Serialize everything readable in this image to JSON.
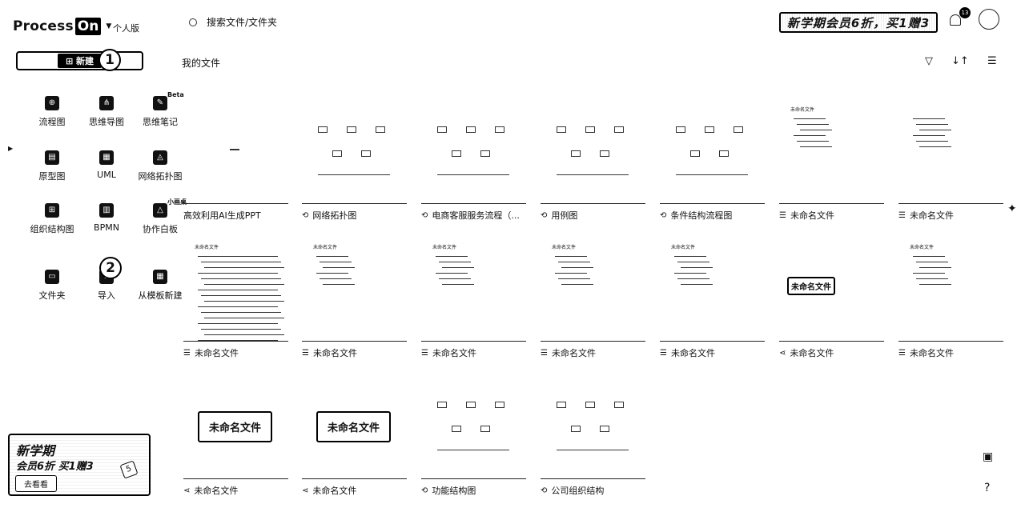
{
  "header": {
    "logo_text": "Process",
    "logo_box": "On",
    "edition": "个人版",
    "search_placeholder": "搜索文件/文件夹",
    "promo": "新学期会员6折，买1赠3",
    "notifications": "13"
  },
  "new_button": {
    "label": "新建",
    "step": "1"
  },
  "section_title": "我的文件",
  "create_tiles": [
    {
      "label": "流程图",
      "icon": "flowchart-icon"
    },
    {
      "label": "思维导图",
      "icon": "mindmap-icon"
    },
    {
      "label": "思维笔记",
      "icon": "mindnote-icon",
      "badge": "Beta"
    },
    {
      "label": "原型图",
      "icon": "prototype-icon"
    },
    {
      "label": "UML",
      "icon": "uml-icon"
    },
    {
      "label": "网络拓扑图",
      "icon": "network-icon"
    },
    {
      "label": "组织结构图",
      "icon": "org-icon"
    },
    {
      "label": "BPMN",
      "icon": "bpmn-icon"
    },
    {
      "label": "协作白板",
      "icon": "whiteboard-icon",
      "badge": "小画桌"
    },
    {
      "label": "文件夹",
      "icon": "folder-icon"
    },
    {
      "label": "导入",
      "icon": "import-icon",
      "step": "2"
    },
    {
      "label": "从模板新建",
      "icon": "template-icon"
    }
  ],
  "side_promo": {
    "line1": "新学期",
    "line2": "会员6折  买1赠3",
    "button": "去看看",
    "number": "5"
  },
  "files": [
    {
      "name": "高效利用AI生成PPT",
      "type": "plain"
    },
    {
      "name": "网络拓扑图",
      "type": "flow"
    },
    {
      "name": "电商客服服务流程（...",
      "type": "flow"
    },
    {
      "name": "用例图",
      "type": "flow"
    },
    {
      "name": "条件结构流程图",
      "type": "flow"
    },
    {
      "name": "未命名文件",
      "type": "note",
      "thumb_title": "未命名文件"
    },
    {
      "name": "未命名文件",
      "type": "note"
    },
    {
      "name": "未命名文件",
      "type": "note",
      "thumb_title": "未命名文件"
    },
    {
      "name": "未命名文件",
      "type": "note",
      "thumb_title": "未命名文件"
    },
    {
      "name": "未命名文件",
      "type": "note",
      "thumb_title": "未命名文件"
    },
    {
      "name": "未命名文件",
      "type": "note",
      "thumb_title": "未命名文件"
    },
    {
      "name": "未命名文件",
      "type": "note",
      "thumb_title": "未命名文件"
    },
    {
      "name": "未命名文件",
      "type": "mind",
      "thumb_title": "未命名文件"
    },
    {
      "name": "未命名文件",
      "type": "note",
      "thumb_title": "未命名文件"
    },
    {
      "name": "未命名文件",
      "type": "mind",
      "thumb_title": "未命名文件"
    },
    {
      "name": "未命名文件",
      "type": "mind",
      "thumb_title": "未命名文件"
    },
    {
      "name": "功能结构图",
      "type": "flow"
    },
    {
      "name": "公司组织结构",
      "type": "flow"
    }
  ],
  "icons": {
    "filter": "filter-icon",
    "sort": "sort-icon",
    "view": "list-view-icon",
    "ai": "ai-sparkle-icon",
    "chat": "chat-icon",
    "help": "?"
  }
}
